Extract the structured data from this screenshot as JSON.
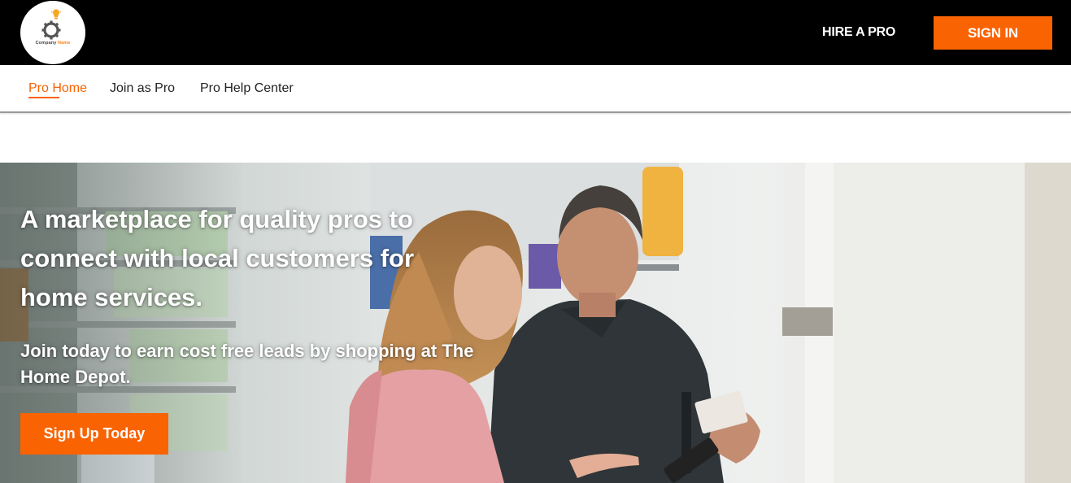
{
  "header": {
    "logo": {
      "icon": "gear-lightbulb-logo",
      "text_part1": "Company",
      "text_part2": "Name"
    },
    "hire_link": "HIRE A PRO",
    "signin_label": "SIGN IN"
  },
  "subnav": {
    "items": [
      {
        "label": "Pro Home",
        "active": true
      },
      {
        "label": "Join as Pro",
        "active": false
      },
      {
        "label": "Pro Help Center",
        "active": false
      }
    ]
  },
  "hero": {
    "title": "A marketplace for quality pros to connect with local customers for home services.",
    "subtitle": "Join today to earn cost free leads by shopping at The Home Depot.",
    "cta_label": "Sign Up Today"
  },
  "colors": {
    "brand_orange": "#f96302",
    "header_bg": "#000000",
    "nav_text": "#222222"
  }
}
